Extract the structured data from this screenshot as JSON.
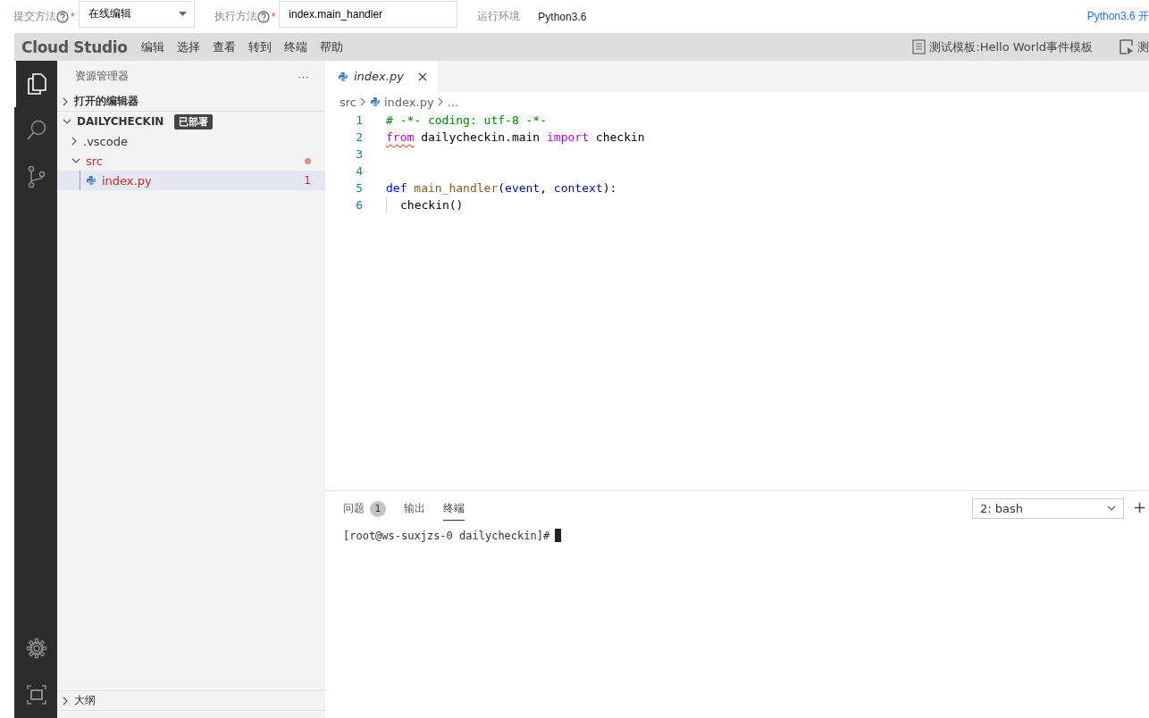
{
  "form": {
    "fields": [
      {
        "kind": "select",
        "label": "提交方法",
        "required_mark": "*",
        "value": "在线编辑"
      },
      {
        "kind": "input",
        "label": "执行方法",
        "required_mark": "*",
        "value": "index.main_handler"
      },
      {
        "kind": "text",
        "label": "运行环境",
        "value": "Python3.6"
      }
    ],
    "link": "Python3.6 开"
  },
  "menubar": {
    "logo": "Cloud Studio",
    "menus": [
      "编辑",
      "选择",
      "查看",
      "转到",
      "终端",
      "帮助"
    ],
    "template": "测试模板:Hello World事件模板",
    "action": "测"
  },
  "activity_bar": [
    {
      "kind": "explorer",
      "selected": true
    },
    {
      "kind": "search",
      "selected": false
    },
    {
      "kind": "scm",
      "selected": false
    }
  ],
  "sidebar": {
    "title": "资源管理器",
    "more": "···",
    "open_editors": {
      "label": "打开的编辑器",
      "expanded": false
    },
    "workspace": {
      "label": "DAILYCHECKIN",
      "badge": "已部署",
      "expanded": true,
      "children": [
        {
          "label": ".vscode",
          "kind": "folder",
          "expanded": false,
          "selected": false,
          "error": false
        },
        {
          "label": "src",
          "kind": "folder",
          "expanded": true,
          "selected": false,
          "error": true,
          "children": [
            {
              "label": "index.py",
              "kind": "python",
              "selected": true,
              "error": true,
              "count": "1"
            }
          ]
        }
      ]
    },
    "bottom_sections": [
      {
        "label": "大纲",
        "expanded": false
      }
    ]
  },
  "editor": {
    "tab": {
      "label": "index.py",
      "selected": true
    },
    "breadcrumb": [
      "src",
      "index.py",
      "..."
    ],
    "lines": [
      {
        "number": "1",
        "tokens": [
          {
            "text": "# -*- coding: utf-8 -*-",
            "kind": "comment"
          }
        ]
      },
      {
        "number": "2",
        "tokens": [
          {
            "text": "from",
            "kind": "keyword",
            "error": true
          },
          {
            "text": " dailycheckin.main ",
            "kind": "plain"
          },
          {
            "text": "import",
            "kind": "keyword"
          },
          {
            "text": " checkin",
            "kind": "plain"
          }
        ]
      },
      {
        "number": "3"
      },
      {
        "number": "4"
      },
      {
        "number": "5",
        "tokens": [
          {
            "text": "def ",
            "kind": "storage"
          },
          {
            "text": "main_handler",
            "kind": "function"
          },
          {
            "text": "(",
            "kind": "plain"
          },
          {
            "text": "event",
            "kind": "param"
          },
          {
            "text": ", ",
            "kind": "plain"
          },
          {
            "text": "context",
            "kind": "param"
          },
          {
            "text": "):",
            "kind": "plain"
          }
        ]
      },
      {
        "number": "6",
        "indent_guide": true,
        "tokens": [
          {
            "text": "checkin()",
            "kind": "plain"
          }
        ]
      }
    ]
  },
  "panel": {
    "tabs": [
      {
        "label": "问题",
        "count": "1",
        "selected": false
      },
      {
        "label": "输出",
        "selected": false
      },
      {
        "label": "终端",
        "selected": true
      }
    ],
    "terminal_select": "2: bash",
    "add": "+",
    "prompt": "[root@ws-suxjzs-0 dailycheckin]#"
  }
}
